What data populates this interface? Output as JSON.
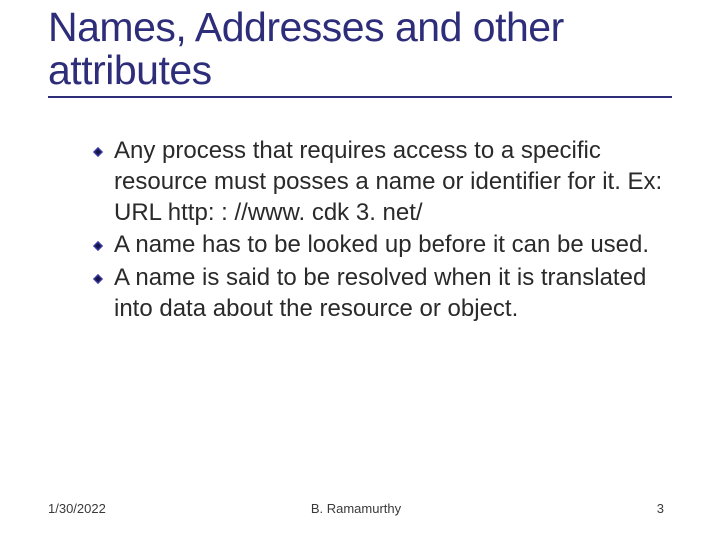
{
  "title": "Names, Addresses and other attributes",
  "bullets": [
    "Any process that requires access to a specific resource must posses a name or identifier for it. Ex: URL http: : //www. cdk 3. net/",
    "A name has to be looked up before it can be used.",
    "A name is said to be resolved when it is translated into data about the resource or object."
  ],
  "footer": {
    "date": "1/30/2022",
    "author": "B. Ramamurthy",
    "page": "3"
  }
}
